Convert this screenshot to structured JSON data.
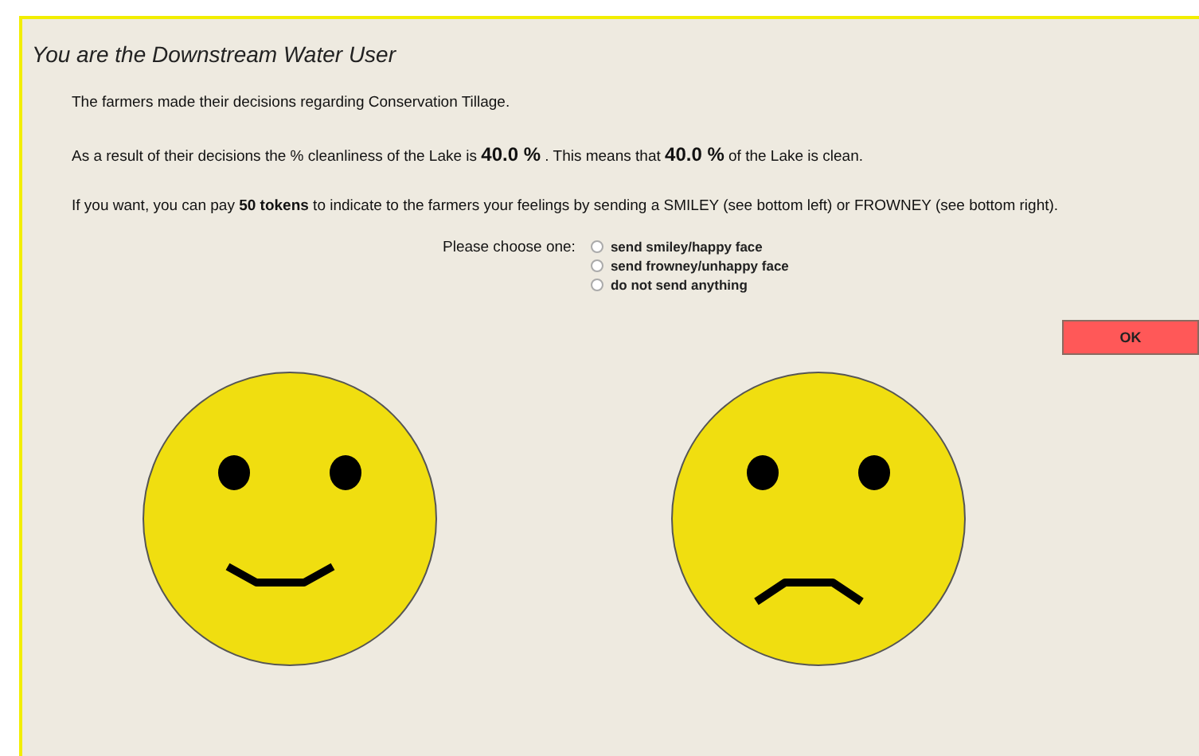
{
  "title": "You are the Downstream Water User",
  "paragraphs": [
    "The farmers made their decisions regarding Conservation Tillage.",
    "As a result of their decisions the % cleanliness of the Lake is **40.0 %** . This means that **40.0 %** of the Lake is clean.",
    "If you want, you can pay **50 tokens** to indicate to the farmers your feelings by sending a SMILEY (see bottom left) or FROWNEY (see bottom right)."
  ],
  "choice": {
    "label": "Please choose one:",
    "options": [
      {
        "label": "send smiley/happy face",
        "selected": false
      },
      {
        "label": "send frowney/unhappy face",
        "selected": false
      },
      {
        "label": "do not send anything",
        "selected": false
      }
    ]
  },
  "ok_button": "OK",
  "faces": [
    {
      "kind": "smiley"
    },
    {
      "kind": "frowney"
    }
  ]
}
